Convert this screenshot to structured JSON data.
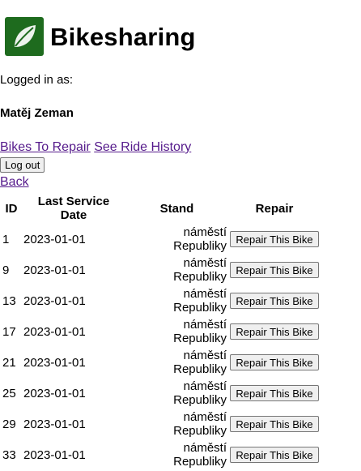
{
  "header": {
    "title": "Bikesharing",
    "logo_icon": "leaf-icon",
    "logo_color": "#1e6b1e"
  },
  "user": {
    "logged_in_label": "Logged in as:",
    "name": "Matěj Zeman"
  },
  "nav": {
    "bikes_to_repair": "Bikes To Repair",
    "ride_history": "See Ride History",
    "logout": "Log out",
    "back": "Back"
  },
  "table": {
    "headers": {
      "id": "ID",
      "date": "Last Service Date",
      "stand": "Stand",
      "repair": "Repair"
    },
    "rows": [
      {
        "id": "1",
        "date": "2023-01-01",
        "stand": "náměstí Republiky",
        "action": "Repair This Bike"
      },
      {
        "id": "9",
        "date": "2023-01-01",
        "stand": "náměstí Republiky",
        "action": "Repair This Bike"
      },
      {
        "id": "13",
        "date": "2023-01-01",
        "stand": "náměstí Republiky",
        "action": "Repair This Bike"
      },
      {
        "id": "17",
        "date": "2023-01-01",
        "stand": "náměstí Republiky",
        "action": "Repair This Bike"
      },
      {
        "id": "21",
        "date": "2023-01-01",
        "stand": "náměstí Republiky",
        "action": "Repair This Bike"
      },
      {
        "id": "25",
        "date": "2023-01-01",
        "stand": "náměstí Republiky",
        "action": "Repair This Bike"
      },
      {
        "id": "29",
        "date": "2023-01-01",
        "stand": "náměstí Republiky",
        "action": "Repair This Bike"
      },
      {
        "id": "33",
        "date": "2023-01-01",
        "stand": "náměstí Republiky",
        "action": "Repair This Bike"
      }
    ]
  }
}
